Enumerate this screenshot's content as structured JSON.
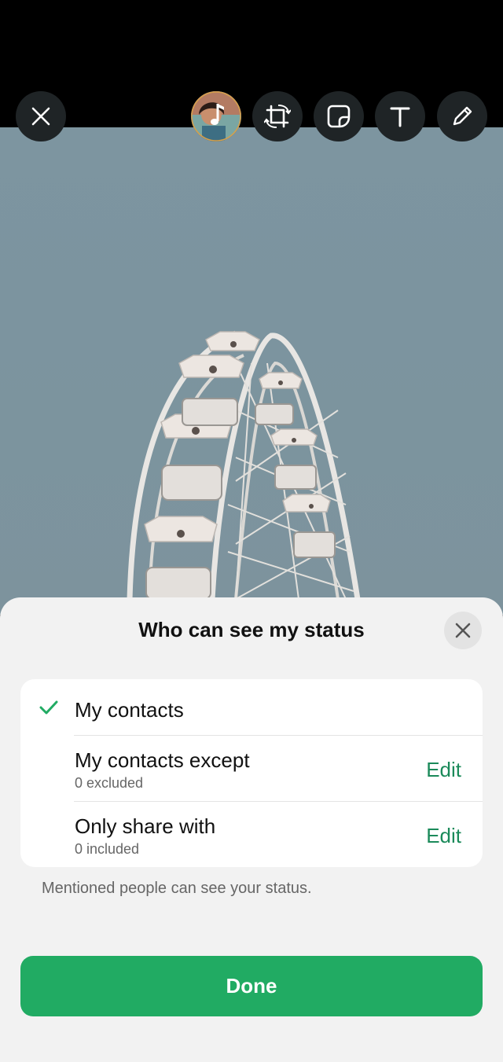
{
  "toolbar": {
    "icons": [
      "close-icon",
      "music-avatar",
      "crop-rotate-icon",
      "sticker-icon",
      "text-icon",
      "pencil-icon"
    ]
  },
  "sheet": {
    "title": "Who can see my status",
    "options": [
      {
        "label": "My contacts",
        "selected": true
      },
      {
        "label": "My contacts except",
        "sub": "0 excluded",
        "action": "Edit"
      },
      {
        "label": "Only share with",
        "sub": "0 included",
        "action": "Edit"
      }
    ],
    "note": "Mentioned people can see your status.",
    "done_label": "Done"
  },
  "colors": {
    "accent": "#21ab63",
    "link": "#1b8a5a",
    "toolbar_bg": "#1f2426",
    "sheet_bg": "#f2f2f2"
  }
}
